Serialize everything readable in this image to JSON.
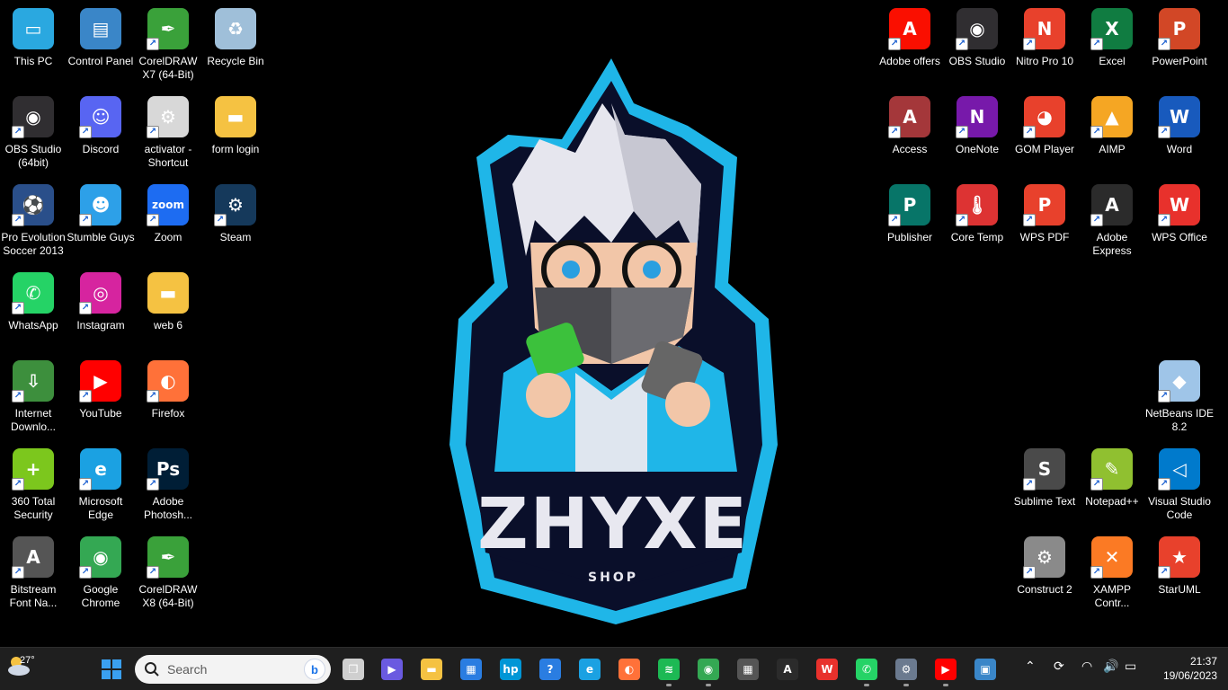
{
  "desktop": {
    "left_icons": [
      {
        "name": "this-pc-icon",
        "label": "This PC",
        "color": "#2aa8e0",
        "glyph": "▭",
        "shortcut": false
      },
      {
        "name": "control-panel-icon",
        "label": "Control Panel",
        "color": "#3a86c8",
        "glyph": "▤",
        "shortcut": false
      },
      {
        "name": "coreldraw-x7-icon",
        "label": "CorelDRAW X7 (64-Bit)",
        "color": "#3aa13a",
        "glyph": "✒",
        "shortcut": true
      },
      {
        "name": "recycle-bin-icon",
        "label": "Recycle Bin",
        "color": "#9fbfd9",
        "glyph": "♻",
        "shortcut": false
      },
      {
        "name": "obs-studio-64-icon",
        "label": "OBS Studio (64bit)",
        "color": "#302e31",
        "glyph": "◉",
        "shortcut": true
      },
      {
        "name": "discord-icon",
        "label": "Discord",
        "color": "#5865f2",
        "glyph": "☺",
        "shortcut": true
      },
      {
        "name": "activator-shortcut-icon",
        "label": "activator - Shortcut",
        "color": "#d8d8d8",
        "glyph": "⚙",
        "shortcut": true
      },
      {
        "name": "form-login-folder-icon",
        "label": "form login",
        "color": "#f5c242",
        "glyph": "▬",
        "shortcut": false
      },
      {
        "name": "pes-2013-icon",
        "label": "Pro Evolution Soccer 2013",
        "color": "#2a4f8a",
        "glyph": "⚽",
        "shortcut": true
      },
      {
        "name": "stumble-guys-icon",
        "label": "Stumble Guys",
        "color": "#2da0e8",
        "glyph": "☻",
        "shortcut": true
      },
      {
        "name": "zoom-icon",
        "label": "Zoom",
        "color": "#1d6cf2",
        "glyph": "zoom",
        "shortcut": true
      },
      {
        "name": "steam-icon",
        "label": "Steam",
        "color": "#15395b",
        "glyph": "⚙",
        "shortcut": true
      },
      {
        "name": "whatsapp-icon",
        "label": "WhatsApp",
        "color": "#25d366",
        "glyph": "✆",
        "shortcut": true
      },
      {
        "name": "instagram-icon",
        "label": "Instagram",
        "color": "#d6249f",
        "glyph": "◎",
        "shortcut": true
      },
      {
        "name": "web6-folder-icon",
        "label": "web 6",
        "color": "#f5c242",
        "glyph": "▬",
        "shortcut": false
      },
      {
        "name": "internet-download-manager-icon",
        "label": "Internet Downlo...",
        "color": "#3d8f3d",
        "glyph": "⇩",
        "shortcut": true
      },
      {
        "name": "youtube-icon",
        "label": "YouTube",
        "color": "#ff0000",
        "glyph": "▶",
        "shortcut": true
      },
      {
        "name": "firefox-icon",
        "label": "Firefox",
        "color": "#ff7139",
        "glyph": "◐",
        "shortcut": true
      },
      {
        "name": "360-total-security-icon",
        "label": "360 Total Security",
        "color": "#7cc71d",
        "glyph": "+",
        "shortcut": true
      },
      {
        "name": "microsoft-edge-icon",
        "label": "Microsoft Edge",
        "color": "#1ba1e2",
        "glyph": "e",
        "shortcut": true
      },
      {
        "name": "adobe-photoshop-icon",
        "label": "Adobe Photosh...",
        "color": "#001e36",
        "glyph": "Ps",
        "shortcut": true
      },
      {
        "name": "bitstream-font-navigator-icon",
        "label": "Bitstream Font Na...",
        "color": "#555555",
        "glyph": "A",
        "shortcut": true
      },
      {
        "name": "google-chrome-icon",
        "label": "Google Chrome",
        "color": "#34a853",
        "glyph": "◉",
        "shortcut": true
      },
      {
        "name": "coreldraw-x8-icon",
        "label": "CorelDRAW X8 (64-Bit)",
        "color": "#3aa13a",
        "glyph": "✒",
        "shortcut": true
      }
    ],
    "right_icons": [
      {
        "name": "adobe-offers-icon",
        "label": "Adobe offers",
        "color": "#fa0f00",
        "glyph": "A",
        "shortcut": true
      },
      {
        "name": "obs-studio-icon",
        "label": "OBS Studio",
        "color": "#302e31",
        "glyph": "◉",
        "shortcut": true
      },
      {
        "name": "nitro-pro-icon",
        "label": "Nitro Pro 10",
        "color": "#e8412c",
        "glyph": "N",
        "shortcut": true
      },
      {
        "name": "excel-icon",
        "label": "Excel",
        "color": "#107c41",
        "glyph": "X",
        "shortcut": true
      },
      {
        "name": "powerpoint-icon",
        "label": "PowerPoint",
        "color": "#d24726",
        "glyph": "P",
        "shortcut": true
      },
      {
        "name": "access-icon",
        "label": "Access",
        "color": "#a4373a",
        "glyph": "A",
        "shortcut": true
      },
      {
        "name": "onenote-icon",
        "label": "OneNote",
        "color": "#7719aa",
        "glyph": "N",
        "shortcut": true
      },
      {
        "name": "gom-player-icon",
        "label": "GOM Player",
        "color": "#e8412c",
        "glyph": "◕",
        "shortcut": true
      },
      {
        "name": "aimp-icon",
        "label": "AIMP",
        "color": "#f5a623",
        "glyph": "▲",
        "shortcut": true
      },
      {
        "name": "word-icon",
        "label": "Word",
        "color": "#185abd",
        "glyph": "W",
        "shortcut": true
      },
      {
        "name": "publisher-icon",
        "label": "Publisher",
        "color": "#077568",
        "glyph": "P",
        "shortcut": true
      },
      {
        "name": "core-temp-icon",
        "label": "Core Temp",
        "color": "#d33",
        "glyph": "🌡",
        "shortcut": true
      },
      {
        "name": "wps-pdf-icon",
        "label": "WPS PDF",
        "color": "#e8412c",
        "glyph": "P",
        "shortcut": true
      },
      {
        "name": "adobe-express-icon",
        "label": "Adobe Express",
        "color": "#2b2b2b",
        "glyph": "A",
        "shortcut": true
      },
      {
        "name": "wps-office-icon",
        "label": "WPS Office",
        "color": "#e8312c",
        "glyph": "W",
        "shortcut": true
      },
      {
        "name": "netbeans-icon",
        "label": "NetBeans IDE 8.2",
        "color": "#9fc5e8",
        "glyph": "◆",
        "shortcut": true
      },
      {
        "name": "sublime-text-icon",
        "label": "Sublime Text",
        "color": "#4a4a4a",
        "glyph": "S",
        "shortcut": true
      },
      {
        "name": "notepad-plus-plus-icon",
        "label": "Notepad++",
        "color": "#90c030",
        "glyph": "✎",
        "shortcut": true
      },
      {
        "name": "visual-studio-code-icon",
        "label": "Visual Studio Code",
        "color": "#007acc",
        "glyph": "◁",
        "shortcut": true
      },
      {
        "name": "construct-2-icon",
        "label": "Construct 2",
        "color": "#8a8a8a",
        "glyph": "⚙",
        "shortcut": true
      },
      {
        "name": "xampp-icon",
        "label": "XAMPP Contr...",
        "color": "#fb7a24",
        "glyph": "✕",
        "shortcut": true
      },
      {
        "name": "staruml-icon",
        "label": "StarUML",
        "color": "#e8412c",
        "glyph": "★",
        "shortcut": true
      }
    ],
    "wallpaper": {
      "brand": "ZHYXE",
      "sub": "SHOP"
    }
  },
  "taskbar": {
    "weather_temp": "27°",
    "search_placeholder": "Search",
    "apps": [
      {
        "name": "task-view-icon",
        "color": "#cfcfcf",
        "glyph": "❐",
        "running": false
      },
      {
        "name": "meet-icon",
        "color": "#6a5ae0",
        "glyph": "▶",
        "running": false
      },
      {
        "name": "file-explorer-icon",
        "color": "#f5c242",
        "glyph": "▬",
        "running": false
      },
      {
        "name": "microsoft-store-icon",
        "color": "#2a7de1",
        "glyph": "▦",
        "running": false
      },
      {
        "name": "myhp-icon",
        "color": "#0096d6",
        "glyph": "hp",
        "running": false
      },
      {
        "name": "get-help-icon",
        "color": "#2a7de1",
        "glyph": "?",
        "running": false
      },
      {
        "name": "edge-taskbar-icon",
        "color": "#1ba1e2",
        "glyph": "e",
        "running": false
      },
      {
        "name": "firefox-taskbar-icon",
        "color": "#ff7139",
        "glyph": "◐",
        "running": false
      },
      {
        "name": "spotify-icon",
        "color": "#1db954",
        "glyph": "≋",
        "running": true
      },
      {
        "name": "chrome-taskbar-icon",
        "color": "#34a853",
        "glyph": "◉",
        "running": true
      },
      {
        "name": "calculator-icon",
        "color": "#555555",
        "glyph": "▦",
        "running": false
      },
      {
        "name": "adobe-express-taskbar-icon",
        "color": "#2b2b2b",
        "glyph": "A",
        "running": false
      },
      {
        "name": "wps-office-taskbar-icon",
        "color": "#e8312c",
        "glyph": "W",
        "running": false
      },
      {
        "name": "whatsapp-taskbar-icon",
        "color": "#25d366",
        "glyph": "✆",
        "running": true
      },
      {
        "name": "settings-taskbar-icon",
        "color": "#6b7a8f",
        "glyph": "⚙",
        "running": true
      },
      {
        "name": "youtube-taskbar-icon",
        "color": "#ff0000",
        "glyph": "▶",
        "running": true
      },
      {
        "name": "remote-desktop-icon",
        "color": "#3a86c8",
        "glyph": "▣",
        "running": false
      }
    ],
    "clock_time": "21:37",
    "clock_date": "19/06/2023"
  }
}
